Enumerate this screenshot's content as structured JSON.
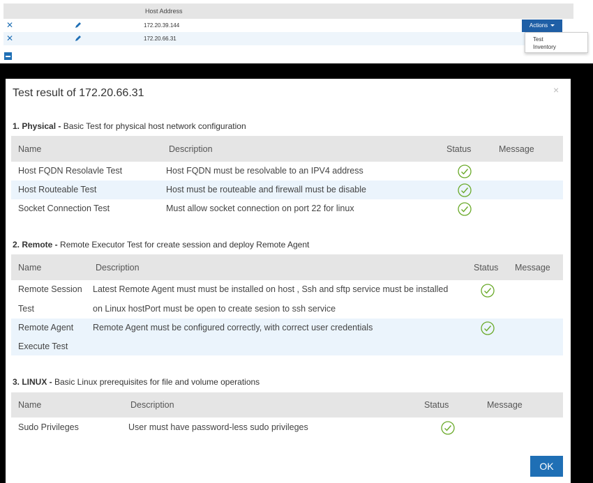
{
  "host_table": {
    "header": "Host Address",
    "rows": [
      {
        "address": "172.20.39.144"
      },
      {
        "address": "172.20.66.31"
      }
    ],
    "actions_label": "Actions",
    "actions_menu": [
      "Test",
      "Inventory"
    ]
  },
  "modal": {
    "title": "Test result of 172.20.66.31",
    "close_symbol": "×",
    "ok_label": "OK",
    "sections": [
      {
        "title_bold": "1. Physical -",
        "title_rest": " Basic Test for physical host network configuration",
        "headers": [
          "Name",
          "Description",
          "Status",
          "Message"
        ],
        "rows": [
          {
            "name": "Host FQDN Resolavle Test",
            "description": "Host FQDN must be resolvable to an IPV4 address",
            "status": "ok"
          },
          {
            "name": "Host Routeable Test",
            "description": "Host must be routeable and firewall must be disable",
            "status": "ok"
          },
          {
            "name": "Socket Connection Test",
            "description": "Must allow socket connection on port 22 for linux",
            "status": "ok"
          }
        ]
      },
      {
        "title_bold": "2. Remote -",
        "title_rest": " Remote Executor Test for create session and deploy Remote Agent",
        "headers": [
          "Name",
          "Description",
          "Status",
          "Message"
        ],
        "rows": [
          {
            "name_line1": "Remote Session",
            "name_line2": "Test",
            "description_line1": "Latest Remote Agent must must be installed on host , Ssh and sftp service must be installed",
            "description_line2": "on Linux hostPort must be open to create sesion to ssh service",
            "status": "ok"
          },
          {
            "name_line1": "Remote Agent",
            "name_line2": "Execute Test",
            "description_line1": "Remote Agent must be configured correctly, with correct user credentials",
            "status": "ok"
          }
        ]
      },
      {
        "title_bold": "3. LINUX -",
        "title_rest": " Basic Linux prerequisites for file and volume operations",
        "headers": [
          "Name",
          "Description",
          "Status",
          "Message"
        ],
        "rows": [
          {
            "name": "Sudo Privileges",
            "description": "User must have password-less sudo privileges",
            "status": "ok"
          }
        ]
      }
    ]
  },
  "colors": {
    "accent": "#1f6fb5",
    "status_ok": "#6aaa2a",
    "header_bg": "#e5e5e5",
    "row_alt": "#ebf4fc"
  }
}
